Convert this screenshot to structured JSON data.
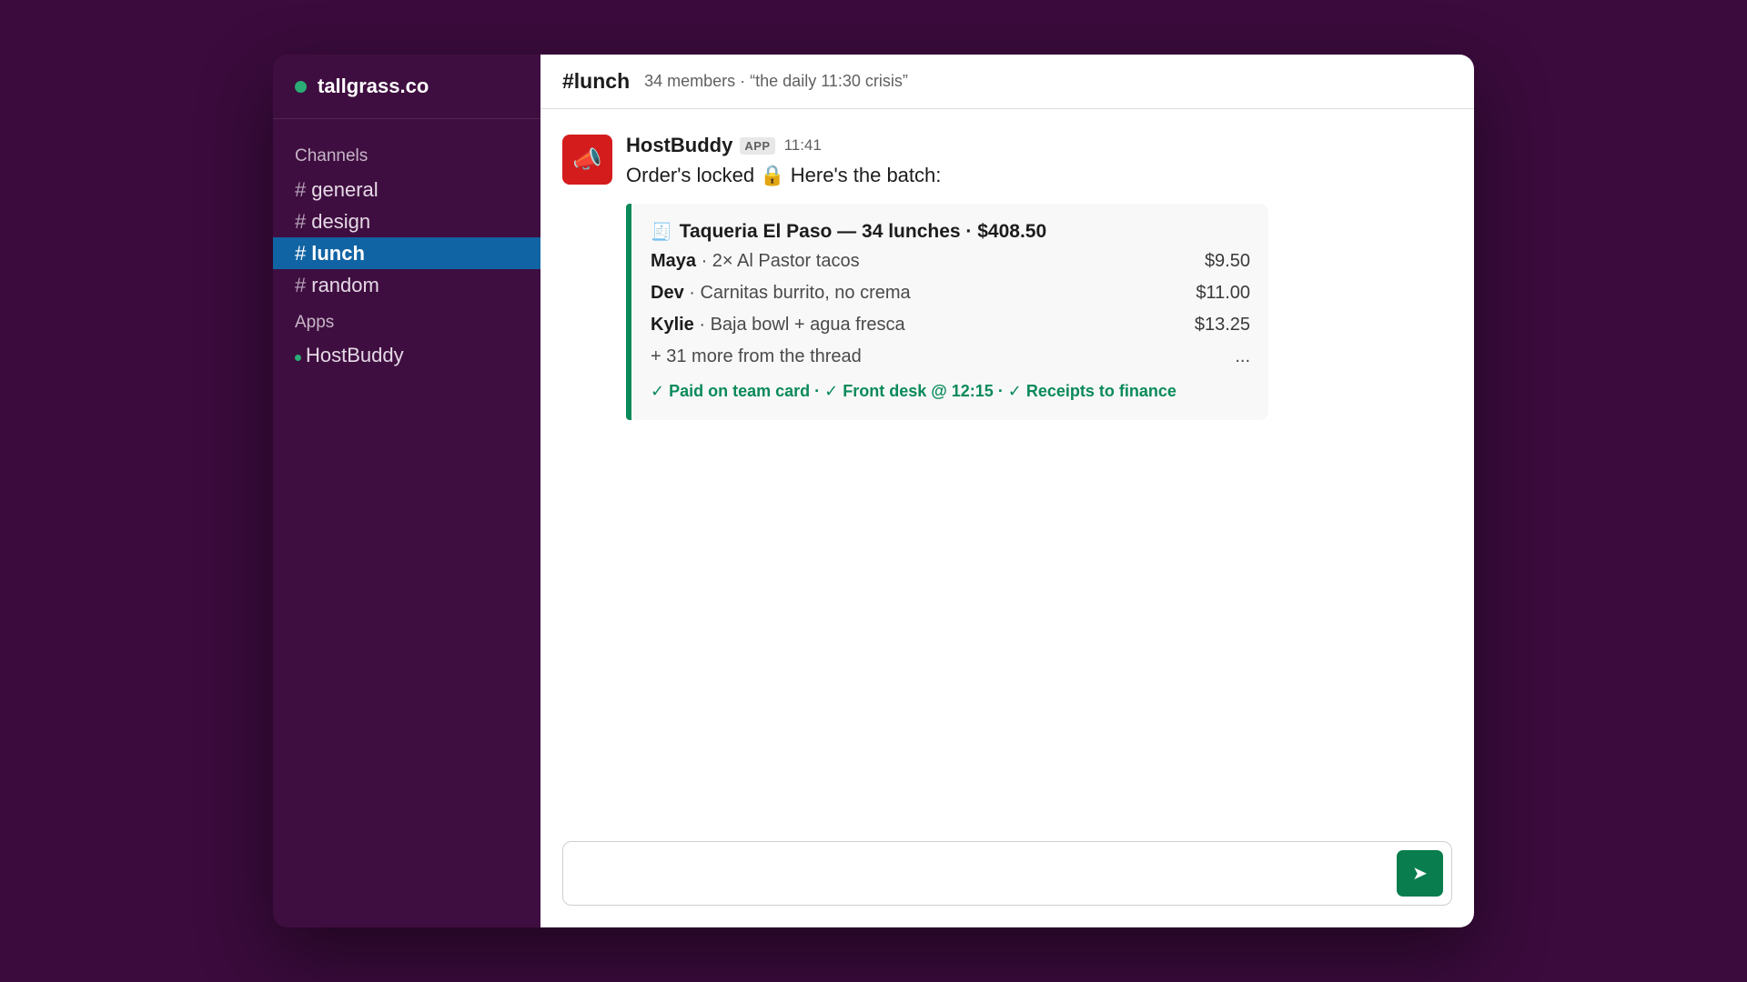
{
  "workspace": {
    "name": "tallgrass.co"
  },
  "sidebar": {
    "channels_label": "Channels",
    "channels": [
      {
        "hash": "#",
        "label": "general",
        "active": false
      },
      {
        "hash": "#",
        "label": "design",
        "active": false
      },
      {
        "hash": "#",
        "label": "lunch",
        "active": true
      },
      {
        "hash": "#",
        "label": "random",
        "active": false
      }
    ],
    "apps_label": "Apps",
    "apps": [
      {
        "label": "HostBuddy"
      }
    ]
  },
  "header": {
    "title": "#lunch",
    "meta": "34 members · “the daily 11:30 crisis”"
  },
  "message": {
    "avatar_emoji": "📣",
    "sender": "HostBuddy",
    "badge": "APP",
    "time": "11:41",
    "text": "Order's locked 🔒 Here's the batch:",
    "card": {
      "icon": "🧾",
      "title": "Taqueria El Paso — 34 lunches · $408.50",
      "orders": [
        {
          "name": "Maya",
          "item": " · 2× Al Pastor tacos",
          "price": "$9.50"
        },
        {
          "name": "Dev",
          "item": " · Carnitas burrito, no crema",
          "price": "$11.00"
        },
        {
          "name": "Kylie",
          "item": " · Baja bowl + agua fresca",
          "price": "$13.25"
        }
      ],
      "more": "+ 31 more from the thread",
      "more_ellipsis": "...",
      "status": "✓ Paid on team card · ✓ Front desk @ 12:15 · ✓ Receipts to finance"
    }
  },
  "composer": {
    "placeholder": "",
    "send_icon": "➤"
  },
  "colors": {
    "background": "#3a0b3c",
    "sidebar": "#3f0e40",
    "active_channel": "#1164a3",
    "accent_green": "#0a8a5a",
    "avatar": "#d41c1c"
  }
}
